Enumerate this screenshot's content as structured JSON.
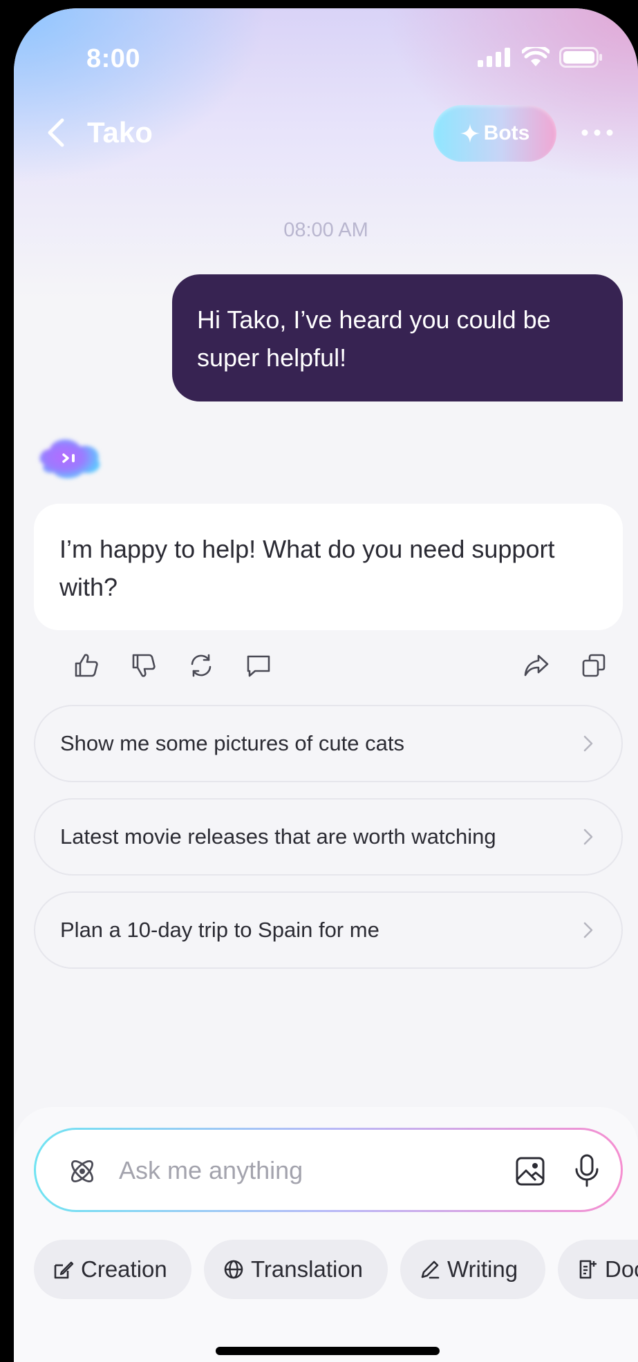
{
  "status_bar": {
    "time": "8:00"
  },
  "nav": {
    "title": "Tako",
    "bots_label": "Bots"
  },
  "chat": {
    "timestamp": "08:00 AM",
    "user_message": "Hi Tako, I’ve heard you could be super helpful!",
    "bot_message": "I’m happy to help! What do you need support with?"
  },
  "suggestions": [
    "Show me some pictures of cute cats",
    "Latest movie releases that are worth watching",
    "Plan a 10-day trip to Spain for me"
  ],
  "composer": {
    "placeholder": "Ask me anything"
  },
  "chips": [
    "Creation",
    "Translation",
    "Writing",
    "Doc"
  ],
  "colors": {
    "user_bubble": "#372352",
    "background": "#f5f5f8",
    "accent_gradient_start": "#6fe3f2",
    "accent_gradient_end": "#f58ed0"
  }
}
